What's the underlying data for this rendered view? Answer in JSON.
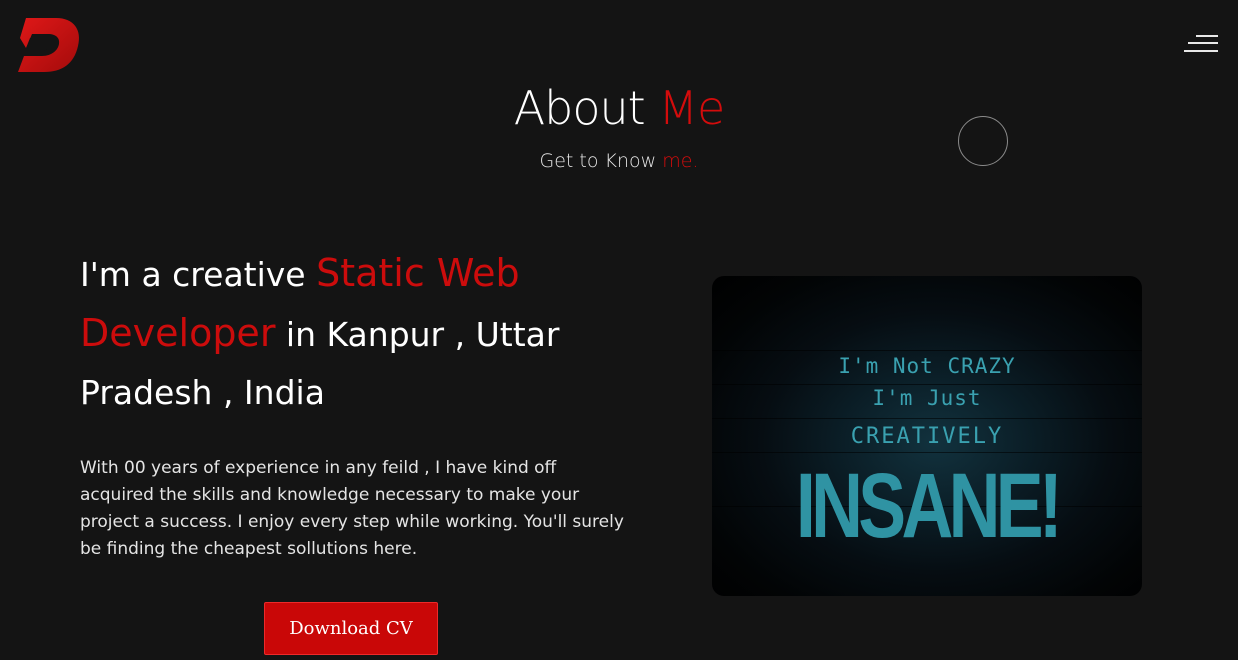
{
  "header": {
    "logo_letter": "D",
    "menu_icon": "hamburger-icon"
  },
  "about": {
    "title_main": "About ",
    "title_accent": "Me",
    "subtitle_main": "Get to Know ",
    "subtitle_accent": "me."
  },
  "intro": {
    "part1": "I'm a creative ",
    "highlight": "Static Web Developer",
    "part2": " in Kanpur , Uttar Pradesh , India",
    "bio": "With 00 years of experience in any feild , I have kind off acquired the skills and knowledge necessary to make your project a success. I enjoy every step while working. You'll surely be finding the cheapest sollutions here.",
    "cv_button": "Download CV"
  },
  "photo": {
    "line1": "I'm Not CRAZY",
    "line2": "I'm Just",
    "line3": "CREATIVELY",
    "line4": "INSANE!"
  },
  "colors": {
    "accent": "#d30c0c",
    "background": "#141414",
    "photo_text": "#3aa1b0"
  }
}
